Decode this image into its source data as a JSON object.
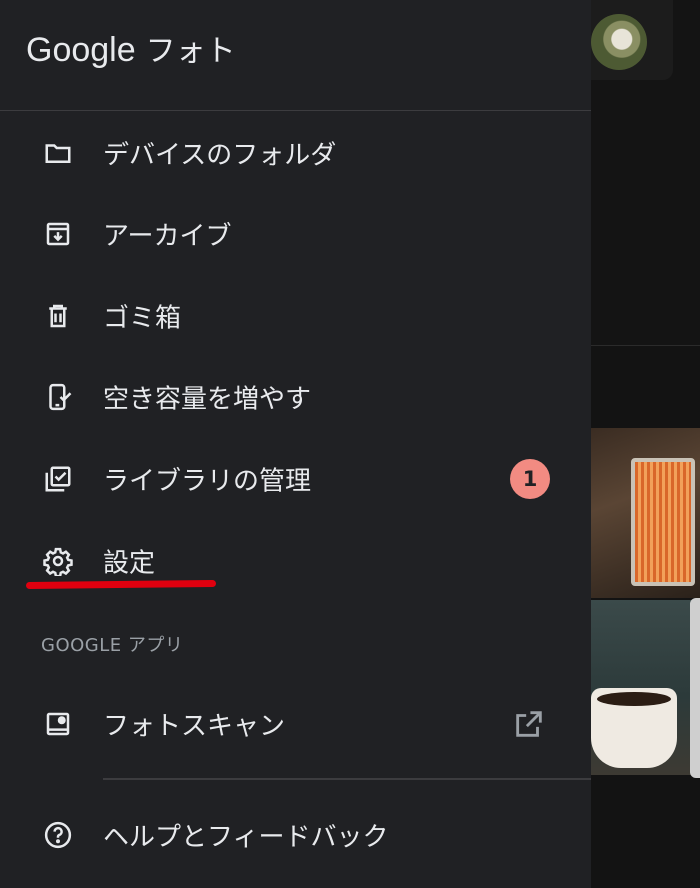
{
  "header": {
    "logo_word": "Google",
    "product_name": "フォト"
  },
  "menu": [
    {
      "label": "デバイスのフォルダ",
      "icon": "folder-icon"
    },
    {
      "label": "アーカイブ",
      "icon": "archive-icon"
    },
    {
      "label": "ゴミ箱",
      "icon": "trash-icon"
    },
    {
      "label": "空き容量を増やす",
      "icon": "phone-check-icon"
    },
    {
      "label": "ライブラリの管理",
      "icon": "library-check-icon",
      "badge": "1"
    },
    {
      "label": "設定",
      "icon": "gear-icon"
    }
  ],
  "section": {
    "title": "GOOGLE アプリ"
  },
  "apps": [
    {
      "label": "フォトスキャン",
      "icon": "photoscan-icon",
      "trailing_icon": "open-external-icon"
    }
  ],
  "footer_items": [
    {
      "label": "ヘルプとフィードバック",
      "icon": "help-icon"
    }
  ],
  "colors": {
    "drawer_bg": "#202124",
    "text": "#e8eaed",
    "secondary_text": "#9aa0a6",
    "badge": "#f28b82",
    "annotation_underline": "#e0000f"
  }
}
